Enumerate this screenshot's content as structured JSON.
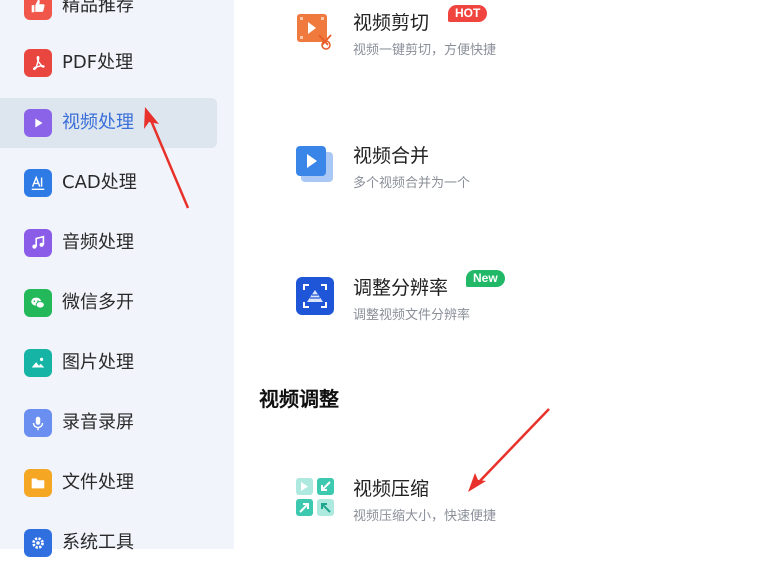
{
  "sidebar": {
    "items": [
      {
        "label": "精品推荐",
        "icon": "thumbs-up-icon",
        "color": "#f0564a"
      },
      {
        "label": "PDF处理",
        "icon": "pdf-icon",
        "color": "#e8463f"
      },
      {
        "label": "视频处理",
        "icon": "play-icon",
        "color": "#8a63e8",
        "active": true
      },
      {
        "label": "CAD处理",
        "icon": "cad-icon",
        "color": "#2e7be6"
      },
      {
        "label": "音频处理",
        "icon": "music-note-icon",
        "color": "#8b5ce8"
      },
      {
        "label": "微信多开",
        "icon": "wechat-icon",
        "color": "#23b95a"
      },
      {
        "label": "图片处理",
        "icon": "image-icon",
        "color": "#16b4a4"
      },
      {
        "label": "录音录屏",
        "icon": "microphone-icon",
        "color": "#6b8ff0"
      },
      {
        "label": "文件处理",
        "icon": "folder-icon",
        "color": "#f5a623"
      },
      {
        "label": "系统工具",
        "icon": "gear-icon",
        "color": "#2f6fe0"
      }
    ]
  },
  "features": [
    {
      "title": "视频剪切",
      "desc": "视频一键剪切，方便快捷",
      "badge": "HOT",
      "icon": "video-cut-icon"
    },
    {
      "title": "视频合并",
      "desc": "多个视频合并为一个",
      "icon": "video-merge-icon"
    },
    {
      "title": "调整分辨率",
      "desc": "调整视频文件分辨率",
      "badge": "New",
      "icon": "resolution-icon"
    }
  ],
  "section": {
    "title": "视频调整",
    "features": [
      {
        "title": "视频压缩",
        "desc": "视频压缩大小，快速便捷",
        "icon": "compress-icon"
      }
    ]
  },
  "colors": {
    "accent": "#3a6fd8",
    "sidebar_bg": "#f1f4fa",
    "annotation_arrow": "#e8312a"
  }
}
